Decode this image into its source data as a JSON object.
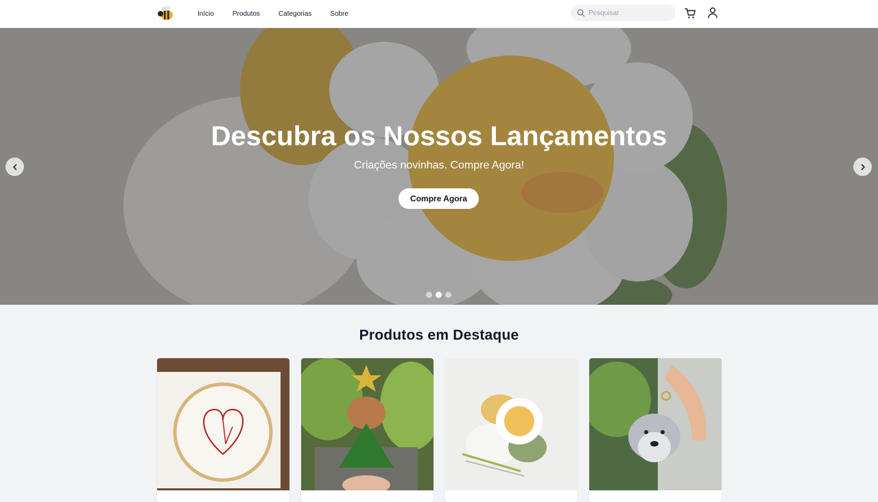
{
  "header": {
    "logo_icon": "bee-logo-icon",
    "nav": [
      "Início",
      "Produtos",
      "Categorias",
      "Sobre"
    ],
    "search_placeholder": "Pesquisar",
    "cart_icon": "cart-icon",
    "user_icon": "user-icon"
  },
  "hero": {
    "title": "Descubra os Nossos Lançamentos",
    "subtitle": "Criações novinhas. Compre Agora!",
    "button_label": "Compre Agora",
    "prev_icon": "chevron-left-icon",
    "next_icon": "chevron-right-icon",
    "slides_count": 3,
    "active_slide": 2
  },
  "featured": {
    "title": "Produtos em Destaque",
    "products": [
      {
        "image": "embroidered-heart-hoop"
      },
      {
        "image": "crochet-capybara-christmas-tree"
      },
      {
        "image": "crochet-daisy-with-yarn"
      },
      {
        "image": "crochet-schnauzer-keychain"
      }
    ]
  },
  "colors": {
    "header_bg": "#ffffff",
    "page_bg": "#f2f3f5",
    "text": "#111827"
  }
}
